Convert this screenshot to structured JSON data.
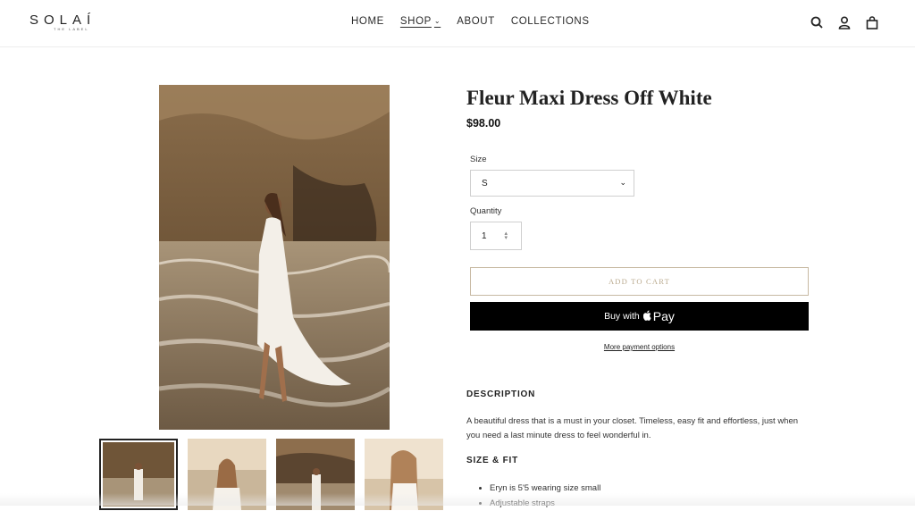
{
  "header": {
    "logo_main": "SOLAÍ",
    "logo_sub": "THE LABEL",
    "nav": [
      {
        "label": "HOME"
      },
      {
        "label": "SHOP"
      },
      {
        "label": "ABOUT"
      },
      {
        "label": "COLLECTIONS"
      }
    ],
    "icons": [
      "search-icon",
      "account-icon",
      "cart-icon"
    ]
  },
  "product": {
    "title": "Fleur Maxi Dress Off White",
    "price": "$98.00",
    "size_label": "Size",
    "size_value": "S",
    "quantity_label": "Quantity",
    "quantity_value": "1",
    "add_to_cart": "ADD TO CART",
    "buy_with": "Buy with",
    "pay": "Pay",
    "more_payment": "More payment options",
    "description_heading": "DESCRIPTION",
    "description_text": "A beautiful dress that is a must in your closet. Timeless, easy fit and effortless, just when you need a last minute dress to feel wonderful in.",
    "size_fit_heading": "SIZE & FIT",
    "size_fit_items": [
      "Eryn is 5'5 wearing size small",
      "Adjustable straps"
    ]
  },
  "colors": {
    "accent_border": "#c7b9a2",
    "accent_text": "#b9a98d",
    "apple_pay_bg": "#000000"
  }
}
